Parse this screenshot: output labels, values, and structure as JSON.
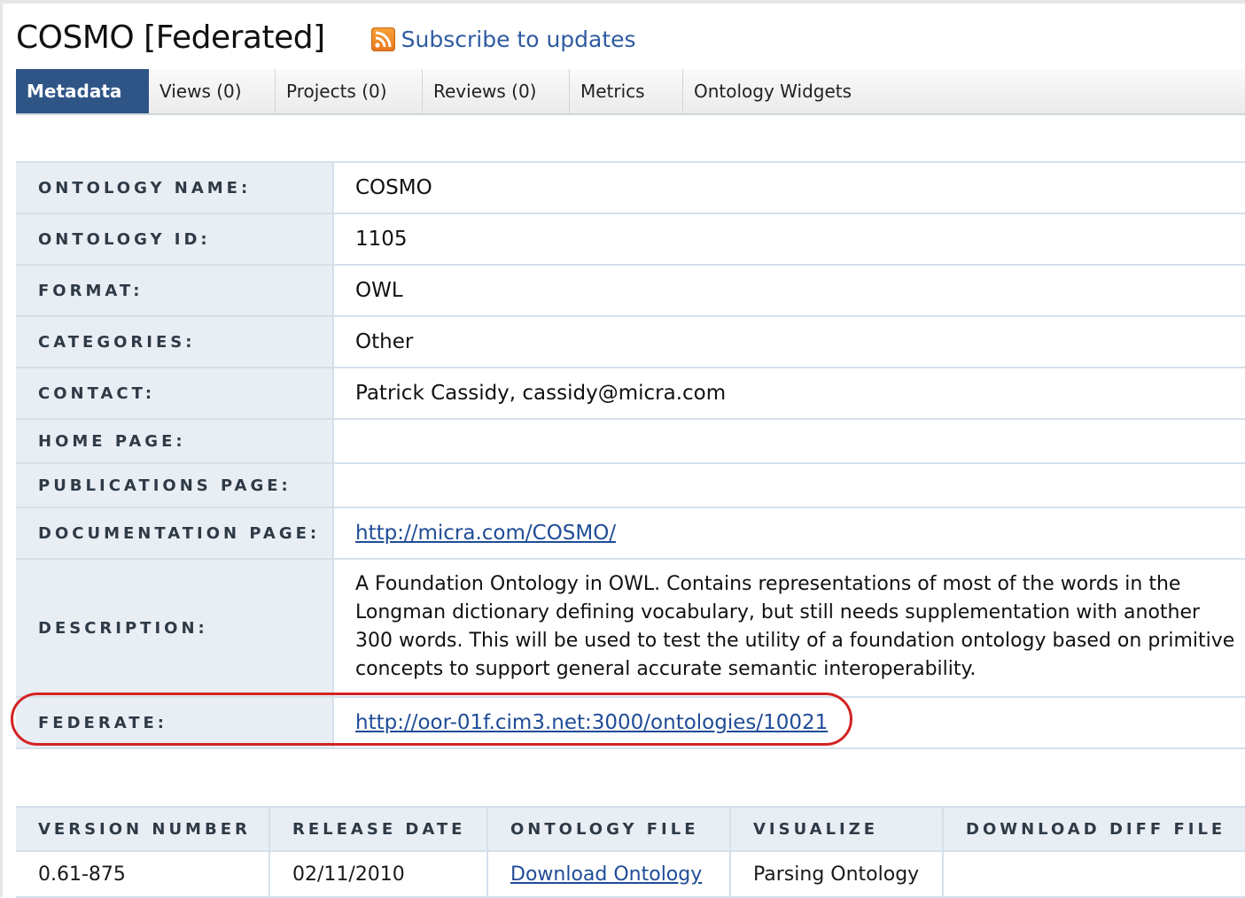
{
  "header": {
    "title": "COSMO [Federated]",
    "subscribe_label": "Subscribe to updates"
  },
  "tabs": [
    {
      "label": "Metadata",
      "active": true
    },
    {
      "label": "Views (0)",
      "active": false
    },
    {
      "label": "Projects (0)",
      "active": false
    },
    {
      "label": "Reviews (0)",
      "active": false
    },
    {
      "label": "Metrics",
      "active": false
    },
    {
      "label": "Ontology Widgets",
      "active": false
    }
  ],
  "metadata": {
    "rows": [
      {
        "label": "ONTOLOGY NAME:",
        "value": "COSMO"
      },
      {
        "label": "ONTOLOGY ID:",
        "value": "1105"
      },
      {
        "label": "FORMAT:",
        "value": "OWL"
      },
      {
        "label": "CATEGORIES:",
        "value": "Other"
      },
      {
        "label": "CONTACT:",
        "value": "Patrick Cassidy, cassidy@micra.com"
      },
      {
        "label": "HOME PAGE:",
        "value": ""
      },
      {
        "label": "PUBLICATIONS PAGE:",
        "value": ""
      },
      {
        "label": "DOCUMENTATION PAGE:",
        "value": "http://micra.com/COSMO/"
      },
      {
        "label": "DESCRIPTION:",
        "value": "A Foundation Ontology in OWL. Contains representations of most of the words in the Longman dictionary defining vocabulary, but still needs supplementation with another 300 words. This will be used to test the utility of a foundation ontology based on primitive concepts to support general accurate semantic interoperability."
      },
      {
        "label": "FEDERATE:",
        "value": "http://oor-01f.cim3.net:3000/ontologies/10021"
      }
    ]
  },
  "versions": {
    "headers": [
      "VERSION NUMBER",
      "RELEASE DATE",
      "ONTOLOGY FILE",
      "VISUALIZE",
      "DOWNLOAD DIFF FILE"
    ],
    "rows": [
      {
        "version": "0.61-875",
        "release_date": "02/11/2010",
        "file": "Download Ontology",
        "visualize": "Parsing Ontology",
        "diff": ""
      }
    ]
  },
  "colors": {
    "active_tab": "#2f5587",
    "label_bg": "#e8eef4",
    "link": "#1f4c97",
    "highlight": "#d42323",
    "rss": "#f7a23a"
  }
}
